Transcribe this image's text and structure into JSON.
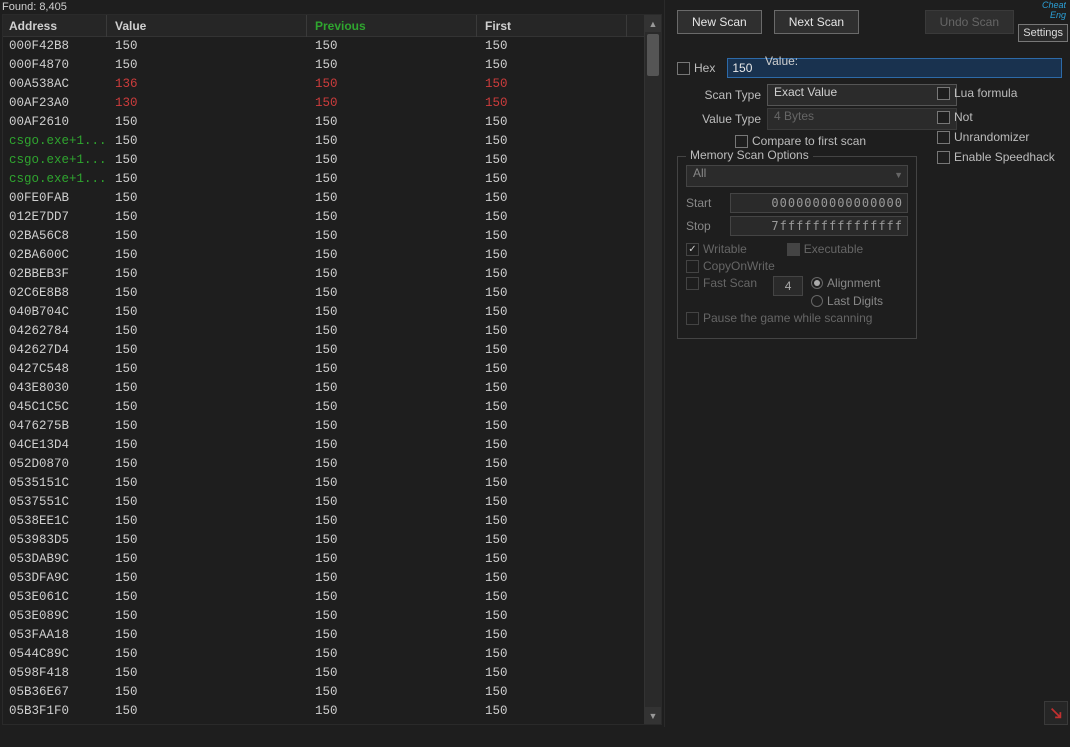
{
  "found_label": "Found:",
  "found_count": "8,405",
  "headers": {
    "address": "Address",
    "value": "Value",
    "previous": "Previous",
    "first": "First"
  },
  "rows": [
    {
      "addr": "000F42B8",
      "val": "150",
      "prev": "150",
      "first": "150",
      "style": "none"
    },
    {
      "addr": "000F4870",
      "val": "150",
      "prev": "150",
      "first": "150",
      "style": "none"
    },
    {
      "addr": "00A538AC",
      "val": "136",
      "prev": "150",
      "first": "150",
      "style": "red"
    },
    {
      "addr": "00AF23A0",
      "val": "130",
      "prev": "150",
      "first": "150",
      "style": "red"
    },
    {
      "addr": "00AF2610",
      "val": "150",
      "prev": "150",
      "first": "150",
      "style": "none"
    },
    {
      "addr": "csgo.exe+1...",
      "val": "150",
      "prev": "150",
      "first": "150",
      "style": "greenaddr"
    },
    {
      "addr": "csgo.exe+1...",
      "val": "150",
      "prev": "150",
      "first": "150",
      "style": "greenaddr"
    },
    {
      "addr": "csgo.exe+1...",
      "val": "150",
      "prev": "150",
      "first": "150",
      "style": "greenaddr"
    },
    {
      "addr": "00FE0FAB",
      "val": "150",
      "prev": "150",
      "first": "150",
      "style": "none"
    },
    {
      "addr": "012E7DD7",
      "val": "150",
      "prev": "150",
      "first": "150",
      "style": "none"
    },
    {
      "addr": "02BA56C8",
      "val": "150",
      "prev": "150",
      "first": "150",
      "style": "none"
    },
    {
      "addr": "02BA600C",
      "val": "150",
      "prev": "150",
      "first": "150",
      "style": "none"
    },
    {
      "addr": "02BBEB3F",
      "val": "150",
      "prev": "150",
      "first": "150",
      "style": "none"
    },
    {
      "addr": "02C6E8B8",
      "val": "150",
      "prev": "150",
      "first": "150",
      "style": "none"
    },
    {
      "addr": "040B704C",
      "val": "150",
      "prev": "150",
      "first": "150",
      "style": "none"
    },
    {
      "addr": "04262784",
      "val": "150",
      "prev": "150",
      "first": "150",
      "style": "none"
    },
    {
      "addr": "042627D4",
      "val": "150",
      "prev": "150",
      "first": "150",
      "style": "none"
    },
    {
      "addr": "0427C548",
      "val": "150",
      "prev": "150",
      "first": "150",
      "style": "none"
    },
    {
      "addr": "043E8030",
      "val": "150",
      "prev": "150",
      "first": "150",
      "style": "none"
    },
    {
      "addr": "045C1C5C",
      "val": "150",
      "prev": "150",
      "first": "150",
      "style": "none"
    },
    {
      "addr": "0476275B",
      "val": "150",
      "prev": "150",
      "first": "150",
      "style": "none"
    },
    {
      "addr": "04CE13D4",
      "val": "150",
      "prev": "150",
      "first": "150",
      "style": "none"
    },
    {
      "addr": "052D0870",
      "val": "150",
      "prev": "150",
      "first": "150",
      "style": "none"
    },
    {
      "addr": "0535151C",
      "val": "150",
      "prev": "150",
      "first": "150",
      "style": "none"
    },
    {
      "addr": "0537551C",
      "val": "150",
      "prev": "150",
      "first": "150",
      "style": "none"
    },
    {
      "addr": "0538EE1C",
      "val": "150",
      "prev": "150",
      "first": "150",
      "style": "none"
    },
    {
      "addr": "053983D5",
      "val": "150",
      "prev": "150",
      "first": "150",
      "style": "none"
    },
    {
      "addr": "053DAB9C",
      "val": "150",
      "prev": "150",
      "first": "150",
      "style": "none"
    },
    {
      "addr": "053DFA9C",
      "val": "150",
      "prev": "150",
      "first": "150",
      "style": "none"
    },
    {
      "addr": "053E061C",
      "val": "150",
      "prev": "150",
      "first": "150",
      "style": "none"
    },
    {
      "addr": "053E089C",
      "val": "150",
      "prev": "150",
      "first": "150",
      "style": "none"
    },
    {
      "addr": "053FAA18",
      "val": "150",
      "prev": "150",
      "first": "150",
      "style": "none"
    },
    {
      "addr": "0544C89C",
      "val": "150",
      "prev": "150",
      "first": "150",
      "style": "none"
    },
    {
      "addr": "0598F418",
      "val": "150",
      "prev": "150",
      "first": "150",
      "style": "none"
    },
    {
      "addr": "05B36E67",
      "val": "150",
      "prev": "150",
      "first": "150",
      "style": "none"
    },
    {
      "addr": "05B3F1F0",
      "val": "150",
      "prev": "150",
      "first": "150",
      "style": "none"
    }
  ],
  "buttons": {
    "new_scan": "New Scan",
    "next_scan": "Next Scan",
    "undo_scan": "Undo Scan",
    "settings": "Settings"
  },
  "value_label": "Value:",
  "hex_label": "Hex",
  "value_input": "150",
  "scan_type_label": "Scan Type",
  "scan_type_value": "Exact Value",
  "value_type_label": "Value Type",
  "value_type_value": "4 Bytes",
  "lua_formula": "Lua formula",
  "not_label": "Not",
  "compare_first": "Compare to first scan",
  "unrandomizer": "Unrandomizer",
  "enable_speedhack": "Enable Speedhack",
  "mso_legend": "Memory Scan Options",
  "mso_region": "All",
  "mso_start_label": "Start",
  "mso_start": "0000000000000000",
  "mso_stop_label": "Stop",
  "mso_stop": "7fffffffffffffff",
  "writable": "Writable",
  "executable": "Executable",
  "copyonwrite": "CopyOnWrite",
  "fast_scan": "Fast Scan",
  "fast_scan_val": "4",
  "alignment": "Alignment",
  "last_digits": "Last Digits",
  "pause_game": "Pause the game while scanning",
  "logo_text": "Cheat Eng"
}
